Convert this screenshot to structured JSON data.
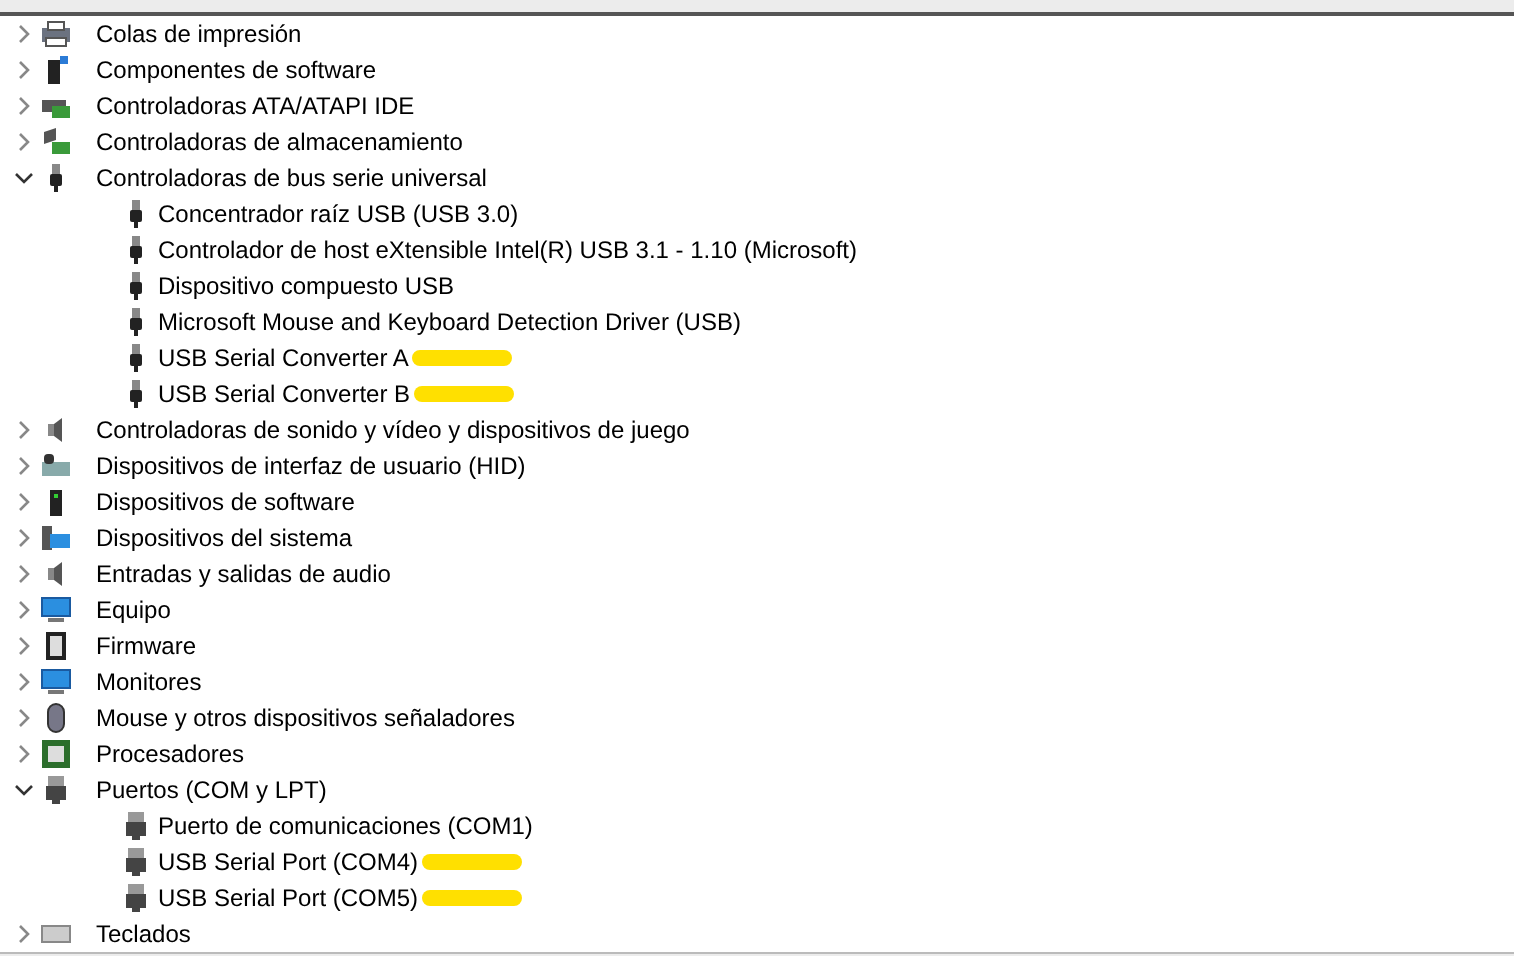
{
  "tree": [
    {
      "label": "Colas de impresión",
      "expanded": false
    },
    {
      "label": "Componentes de software",
      "expanded": false
    },
    {
      "label": "Controladoras ATA/ATAPI IDE",
      "expanded": false
    },
    {
      "label": "Controladoras de almacenamiento",
      "expanded": false
    },
    {
      "label": "Controladoras de bus serie universal",
      "expanded": true,
      "children": [
        {
          "label": "Concentrador raíz USB (USB 3.0)",
          "highlighted": false
        },
        {
          "label": "Controlador de host eXtensible Intel(R) USB 3.1 - 1.10 (Microsoft)",
          "highlighted": false
        },
        {
          "label": "Dispositivo compuesto USB",
          "highlighted": false
        },
        {
          "label": "Microsoft Mouse and Keyboard Detection Driver (USB)",
          "highlighted": false
        },
        {
          "label": "USB Serial Converter A",
          "highlighted": true
        },
        {
          "label": "USB Serial Converter B",
          "highlighted": true
        }
      ]
    },
    {
      "label": "Controladoras de sonido y vídeo y dispositivos de juego",
      "expanded": false
    },
    {
      "label": "Dispositivos de interfaz de usuario (HID)",
      "expanded": false
    },
    {
      "label": "Dispositivos de software",
      "expanded": false
    },
    {
      "label": "Dispositivos del sistema",
      "expanded": false
    },
    {
      "label": "Entradas y salidas de audio",
      "expanded": false
    },
    {
      "label": "Equipo",
      "expanded": false
    },
    {
      "label": "Firmware",
      "expanded": false
    },
    {
      "label": "Monitores",
      "expanded": false
    },
    {
      "label": "Mouse y otros dispositivos señaladores",
      "expanded": false
    },
    {
      "label": "Procesadores",
      "expanded": false
    },
    {
      "label": "Puertos (COM y LPT)",
      "expanded": true,
      "children": [
        {
          "label": "Puerto de comunicaciones (COM1)",
          "highlighted": false
        },
        {
          "label": "USB Serial Port (COM4)",
          "highlighted": true
        },
        {
          "label": "USB Serial Port (COM5)",
          "highlighted": true
        }
      ]
    },
    {
      "label": "Teclados",
      "expanded": false
    }
  ]
}
